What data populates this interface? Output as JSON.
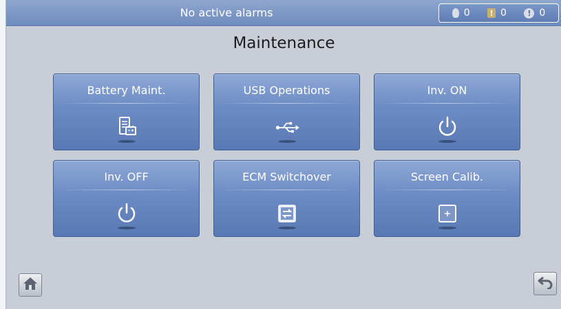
{
  "status_bar": {
    "message": "No active alarms",
    "alarms": [
      {
        "icon": "critical-alarm-icon",
        "count": "0"
      },
      {
        "icon": "major-alarm-icon",
        "count": "0"
      },
      {
        "icon": "minor-alarm-icon",
        "count": "0"
      }
    ]
  },
  "page": {
    "title": "Maintenance"
  },
  "tiles": [
    {
      "label": "Battery Maint.",
      "icon": "battery-maintenance-icon"
    },
    {
      "label": "USB Operations",
      "icon": "usb-icon"
    },
    {
      "label": "Inv. ON",
      "icon": "power-icon"
    },
    {
      "label": "Inv. OFF",
      "icon": "power-icon"
    },
    {
      "label": "ECM Switchover",
      "icon": "switchover-icon"
    },
    {
      "label": "Screen Calib.",
      "icon": "screen-calibration-icon"
    }
  ],
  "nav": {
    "home_icon": "home-icon",
    "back_icon": "back-icon"
  },
  "colors": {
    "tile_top": "#8ea8d6",
    "tile_bottom": "#5a79b4",
    "status_bar": "#7a95c6",
    "background": "#c9ced6"
  }
}
